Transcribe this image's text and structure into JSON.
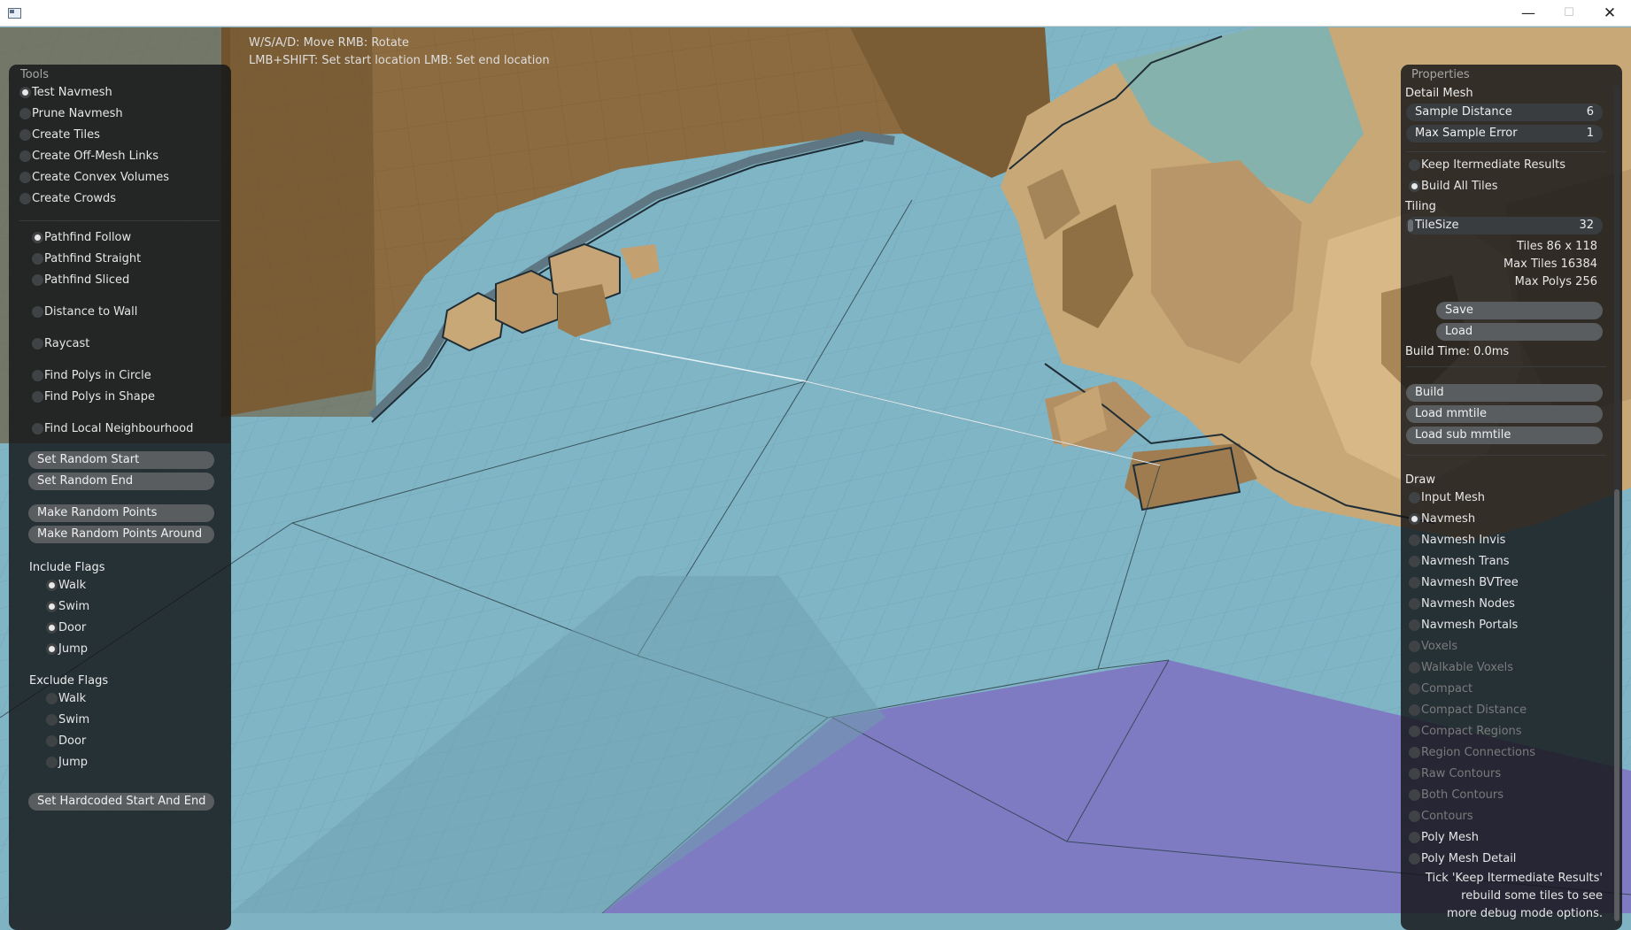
{
  "window": {
    "minimize_glyph": "—",
    "maximize_glyph": "☐",
    "close_glyph": "✕"
  },
  "help": {
    "line1": "W/S/A/D: Move  RMB: Rotate",
    "line2": "LMB+SHIFT: Set start location  LMB: Set end location"
  },
  "tools": {
    "title": "Tools",
    "tool_items": [
      {
        "label": "Test Navmesh",
        "selected": true
      },
      {
        "label": "Prune Navmesh",
        "selected": false
      },
      {
        "label": "Create Tiles",
        "selected": false
      },
      {
        "label": "Create Off-Mesh Links",
        "selected": false
      },
      {
        "label": "Create Convex Volumes",
        "selected": false
      },
      {
        "label": "Create Crowds",
        "selected": false
      }
    ],
    "modes": [
      {
        "label": "Pathfind Follow",
        "selected": true
      },
      {
        "label": "Pathfind Straight",
        "selected": false
      },
      {
        "label": "Pathfind Sliced",
        "selected": false
      },
      {
        "label": "Distance to Wall",
        "selected": false
      },
      {
        "label": "Raycast",
        "selected": false
      },
      {
        "label": "Find Polys in Circle",
        "selected": false
      },
      {
        "label": "Find Polys in Shape",
        "selected": false
      },
      {
        "label": "Find Local Neighbourhood",
        "selected": false
      }
    ],
    "buttons": {
      "set_random_start": "Set Random Start",
      "set_random_end": "Set Random End",
      "make_random_points": "Make Random Points",
      "make_random_points_around": "Make Random Points Around",
      "set_hardcoded": "Set Hardcoded Start And End"
    },
    "include_flags": {
      "title": "Include Flags",
      "items": [
        {
          "label": "Walk",
          "checked": true
        },
        {
          "label": "Swim",
          "checked": true
        },
        {
          "label": "Door",
          "checked": true
        },
        {
          "label": "Jump",
          "checked": true
        }
      ]
    },
    "exclude_flags": {
      "title": "Exclude Flags",
      "items": [
        {
          "label": "Walk",
          "checked": false
        },
        {
          "label": "Swim",
          "checked": false
        },
        {
          "label": "Door",
          "checked": false
        },
        {
          "label": "Jump",
          "checked": false
        }
      ]
    }
  },
  "properties": {
    "title": "Properties",
    "detail_mesh": {
      "title": "Detail Mesh",
      "sample_distance": {
        "label": "Sample Distance",
        "value": "6"
      },
      "max_sample_error": {
        "label": "Max Sample Error",
        "value": "1"
      }
    },
    "keep_intermediate": {
      "label": "Keep Itermediate Results",
      "checked": false
    },
    "build_all_tiles": {
      "label": "Build All Tiles",
      "checked": true
    },
    "tiling": {
      "title": "Tiling",
      "tile_size": {
        "label": "TileSize",
        "value": "32"
      },
      "tiles": "Tiles  86 x 118",
      "max_tiles": "Max Tiles  16384",
      "max_polys": "Max Polys  256"
    },
    "save": "Save",
    "load": "Load",
    "build_time": "Build Time: 0.0ms",
    "build": "Build",
    "load_mmtile": "Load mmtile",
    "load_sub_mmtile": "Load sub mmtile",
    "draw": {
      "title": "Draw",
      "items": [
        {
          "label": "Input Mesh",
          "checked": false,
          "enabled": true
        },
        {
          "label": "Navmesh",
          "checked": true,
          "enabled": true
        },
        {
          "label": "Navmesh Invis",
          "checked": false,
          "enabled": true
        },
        {
          "label": "Navmesh Trans",
          "checked": false,
          "enabled": true
        },
        {
          "label": "Navmesh BVTree",
          "checked": false,
          "enabled": true
        },
        {
          "label": "Navmesh Nodes",
          "checked": false,
          "enabled": true
        },
        {
          "label": "Navmesh Portals",
          "checked": false,
          "enabled": true
        },
        {
          "label": "Voxels",
          "checked": false,
          "enabled": false
        },
        {
          "label": "Walkable Voxels",
          "checked": false,
          "enabled": false
        },
        {
          "label": "Compact",
          "checked": false,
          "enabled": false
        },
        {
          "label": "Compact Distance",
          "checked": false,
          "enabled": false
        },
        {
          "label": "Compact Regions",
          "checked": false,
          "enabled": false
        },
        {
          "label": "Region Connections",
          "checked": false,
          "enabled": false
        },
        {
          "label": "Raw Contours",
          "checked": false,
          "enabled": false
        },
        {
          "label": "Both Contours",
          "checked": false,
          "enabled": false
        },
        {
          "label": "Contours",
          "checked": false,
          "enabled": false
        },
        {
          "label": "Poly Mesh",
          "checked": false,
          "enabled": true
        },
        {
          "label": "Poly Mesh Detail",
          "checked": false,
          "enabled": true
        }
      ]
    },
    "hint_lines": [
      "Tick 'Keep Itermediate Results'",
      "rebuild some tiles to see",
      "more debug mode options."
    ]
  },
  "colors": {
    "navmesh": "#80b5c6",
    "wall": "#8a6a3e",
    "rock": "#cfae7d",
    "purple_area": "#7e7bc2"
  }
}
